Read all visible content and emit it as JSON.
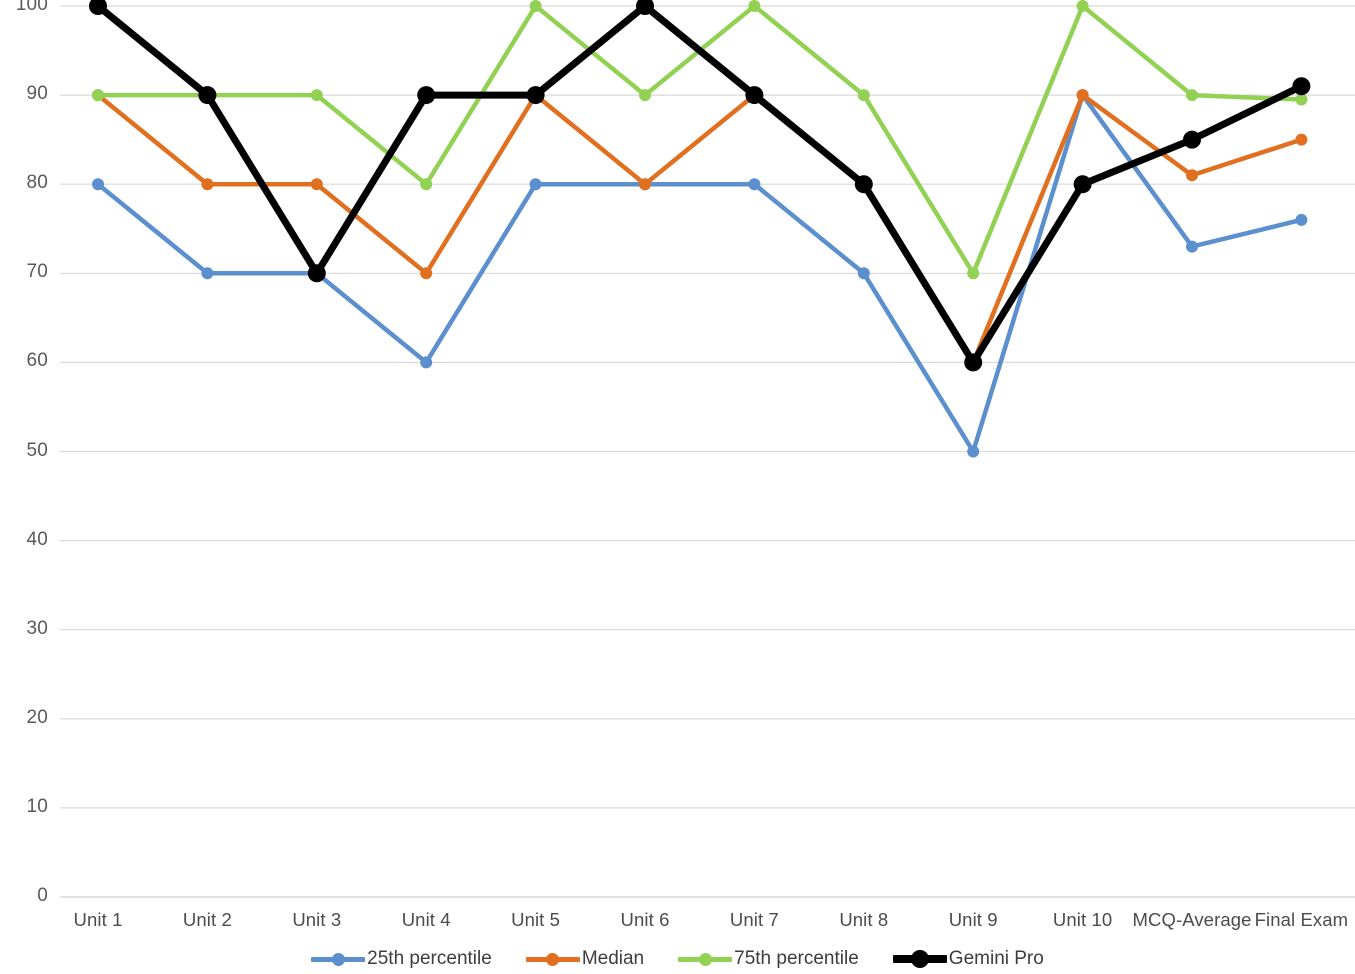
{
  "chart_data": {
    "type": "line",
    "title": "",
    "xlabel": "",
    "ylabel": "",
    "ylim": [
      0,
      100
    ],
    "y_ticks": [
      0,
      10,
      20,
      30,
      40,
      50,
      60,
      70,
      80,
      90,
      100
    ],
    "grid": true,
    "legend_position": "bottom",
    "categories": [
      "Unit 1",
      "Unit 2",
      "Unit 3",
      "Unit 4",
      "Unit 5",
      "Unit 6",
      "Unit 7",
      "Unit 8",
      "Unit 9",
      "Unit 10",
      "MCQ-Average",
      "Final Exam"
    ],
    "series": [
      {
        "name": "25th percentile",
        "color": "#5B8FCD",
        "values": [
          80,
          70,
          70,
          60,
          80,
          80,
          80,
          70,
          50,
          90,
          73,
          76
        ]
      },
      {
        "name": "Median",
        "color": "#E0701F",
        "values": [
          90,
          80,
          80,
          70,
          90,
          80,
          90,
          80,
          60,
          90,
          81,
          85
        ]
      },
      {
        "name": "75th percentile",
        "color": "#92D154",
        "values": [
          90,
          90,
          90,
          80,
          100,
          90,
          100,
          90,
          70,
          100,
          90,
          89.5
        ]
      },
      {
        "name": "Gemini Pro",
        "color": "#000000",
        "values": [
          100,
          90,
          70,
          90,
          90,
          100,
          90,
          80,
          60,
          80,
          85,
          91
        ]
      }
    ]
  },
  "axis": {
    "y_tick_labels": [
      "100",
      "90",
      "80",
      "70",
      "60",
      "50",
      "40",
      "30",
      "20",
      "10",
      "0"
    ],
    "x_tick_labels": [
      "Unit 1",
      "Unit 2",
      "Unit 3",
      "Unit 4",
      "Unit 5",
      "Unit 6",
      "Unit 7",
      "Unit 8",
      "Unit 9",
      "Unit 10",
      "MCQ-Average",
      "Final Exam"
    ]
  },
  "legend": {
    "items": [
      {
        "label": "25th percentile",
        "color": "#5B8FCD",
        "thick": false
      },
      {
        "label": "Median",
        "color": "#E0701F",
        "thick": false
      },
      {
        "label": "75th percentile",
        "color": "#92D154",
        "thick": false
      },
      {
        "label": "Gemini Pro",
        "color": "#000000",
        "thick": true
      }
    ]
  },
  "style": {
    "gridline_color": "#D9D9D9",
    "background": "#FFFFFF",
    "tick_text_color": "#5A5A5A"
  }
}
